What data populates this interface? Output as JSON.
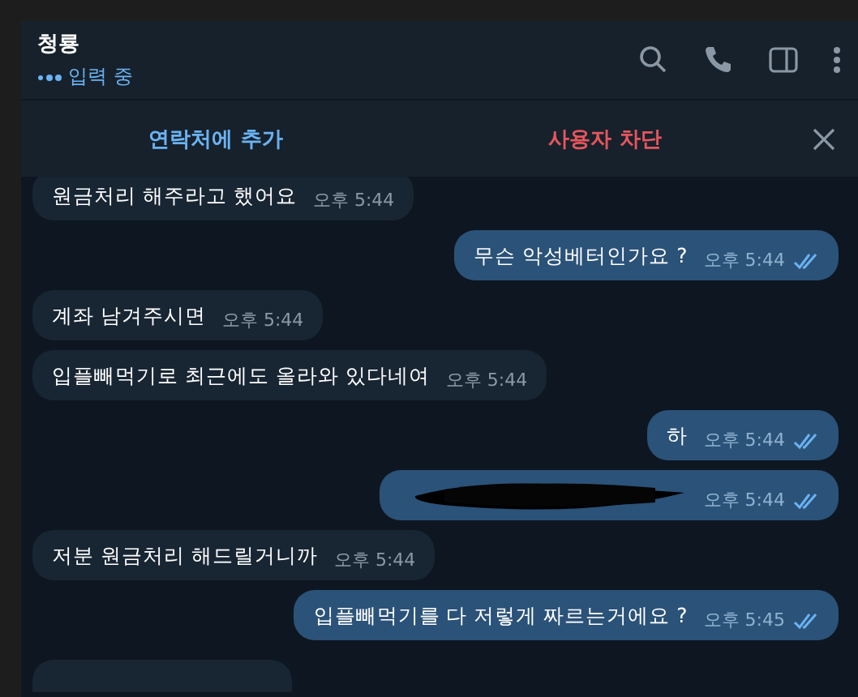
{
  "header": {
    "title": "청룡",
    "status": "입력 중"
  },
  "action_bar": {
    "add_contact": "연락처에 추가",
    "block_user": "사용자 차단"
  },
  "messages": [
    {
      "kind": "incoming",
      "text": "원금처리 해주라고 했어요",
      "time": "오후 5:44"
    },
    {
      "kind": "outgoing",
      "text": "무슨 악성베터인가요 ?",
      "time": "오후 5:44",
      "read": true
    },
    {
      "kind": "incoming",
      "text": "계좌 남겨주시면",
      "time": "오후 5:44"
    },
    {
      "kind": "incoming",
      "text": "입플빼먹기로 최근에도 올라와 있다네여",
      "time": "오후 5:44"
    },
    {
      "kind": "outgoing",
      "text": "하",
      "time": "오후 5:44",
      "read": true
    },
    {
      "kind": "redacted",
      "time": "오후 5:44",
      "read": true
    },
    {
      "kind": "incoming",
      "text": "저분 원금처리 해드릴거니까",
      "time": "오후 5:44"
    },
    {
      "kind": "outgoing",
      "text": "입플빼먹기를 다 저렇게 짜르는거에요 ?",
      "time": "오후 5:45",
      "read": true
    },
    {
      "kind": "partial"
    }
  ]
}
